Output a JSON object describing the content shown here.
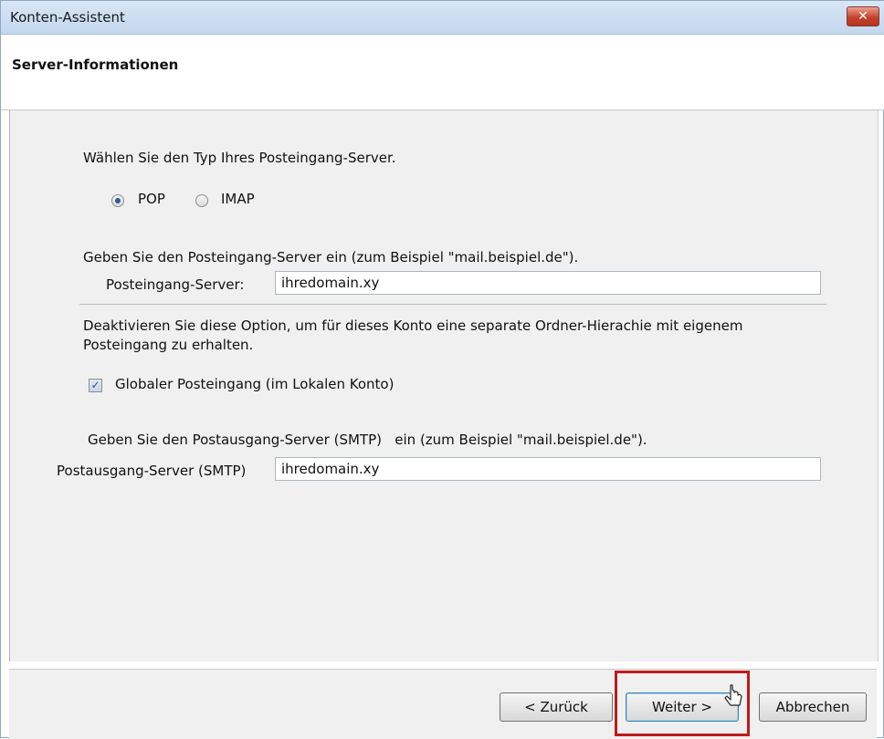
{
  "window": {
    "title": "Konten-Assistent",
    "close_glyph": "✕"
  },
  "header": {
    "title": "Server-Informationen"
  },
  "incoming": {
    "type_prompt": "Wählen Sie den Typ Ihres Posteingang-Server.",
    "options": [
      {
        "label": "POP",
        "selected": true
      },
      {
        "label": "IMAP",
        "selected": false
      }
    ],
    "server_prompt": "Geben Sie den Posteingang-Server ein (zum Beispiel \"mail.beispiel.de\").",
    "server_label": "Posteingang-Server:",
    "server_value": "ihredomain.xy"
  },
  "global_inbox": {
    "description": "Deaktivieren Sie diese Option, um für dieses Konto eine separate Ordner-Hierachie mit eigenem Posteingang zu erhalten.",
    "checkbox_label": "Globaler Posteingang (im Lokalen Konto)",
    "checked": true,
    "check_glyph": "✓"
  },
  "outgoing": {
    "server_prompt": "Geben Sie den Postausgang-Server (SMTP)   ein (zum Beispiel \"mail.beispiel.de\").",
    "server_label": "Postausgang-Server (SMTP)",
    "server_value": "ihredomain.xy"
  },
  "buttons": {
    "back": "< Zurück",
    "next": "Weiter >",
    "cancel": "Abbrechen"
  },
  "accent_colors": {
    "highlight": "#c11a1a",
    "radio_dot": "#2d5b9a"
  }
}
